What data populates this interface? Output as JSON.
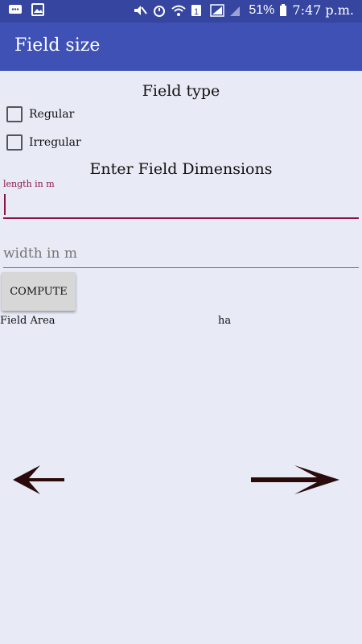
{
  "status_bar": {
    "battery": "51%",
    "time": "7:47 p.m."
  },
  "app_bar": {
    "title": "Field size"
  },
  "field_type": {
    "heading": "Field type",
    "options": [
      {
        "label": "Regular",
        "checked": false
      },
      {
        "label": "Irregular",
        "checked": false
      }
    ]
  },
  "dimensions": {
    "heading": "Enter Field Dimensions",
    "length": {
      "label": "length in m",
      "value": ""
    },
    "width": {
      "placeholder": "width in m",
      "value": ""
    }
  },
  "compute_button": {
    "label": "COMPUTE"
  },
  "result": {
    "label": "Field Area",
    "unit": "ha"
  },
  "navigation": {
    "prev_icon": "arrow-left-icon",
    "next_icon": "arrow-right-icon"
  },
  "colors": {
    "primary": "#3f51b5",
    "primary_dark": "#3545a0",
    "accent": "#8b1446",
    "background": "#e8eaf6"
  }
}
